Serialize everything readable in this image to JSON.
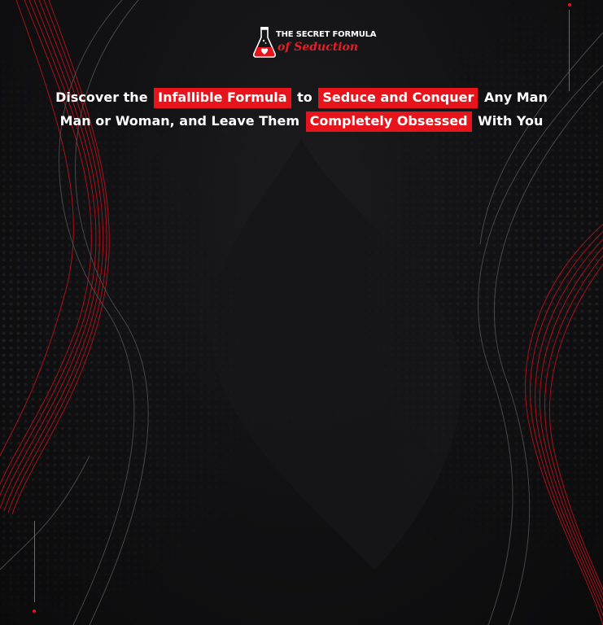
{
  "brand": {
    "line1": "THE SECRET FORMULA",
    "line2": "of Seduction",
    "icon": "flask-heart-icon",
    "accent_color": "#e8141c"
  },
  "headline": {
    "line1": {
      "part1": "Discover the",
      "highlight1": "Infallible Formula",
      "part2": "to",
      "highlight2": "Seduce and Conquer",
      "part3": "Any Man"
    },
    "line2": {
      "part1": "Man or Woman, and Leave Them",
      "highlight1": "Completely Obsessed",
      "part2": "With You"
    }
  },
  "colors": {
    "background": "#0d0d0f",
    "highlight": "#e8141c",
    "text": "#ffffff"
  }
}
